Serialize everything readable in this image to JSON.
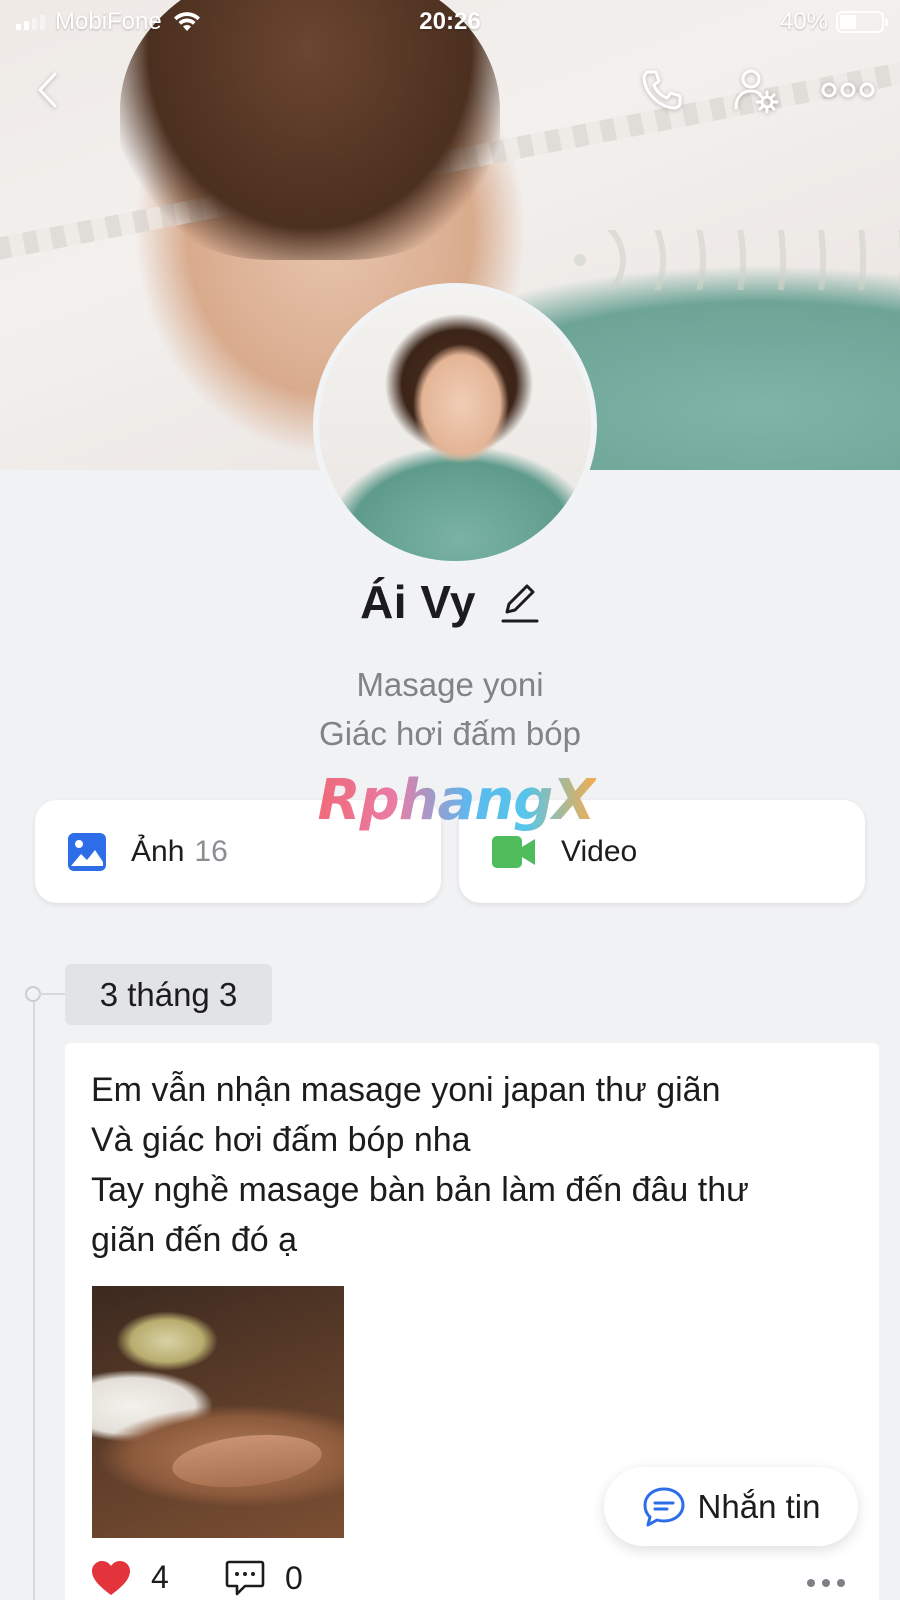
{
  "status_bar": {
    "carrier": "MobiFone",
    "time": "20:26",
    "battery_percent": "40%",
    "battery_level": 0.4
  },
  "nav": {
    "back_icon": "chevron-left-icon",
    "call_icon": "phone-icon",
    "settings_icon": "user-settings-icon",
    "more_icon": "more-horizontal-icon"
  },
  "profile": {
    "name": "Ái Vy",
    "bio_line1": "Masage yoni",
    "bio_line2": "Giác hơi đấm bóp"
  },
  "watermark": "RphangX",
  "media": {
    "photos_label": "Ảnh",
    "photos_count": "16",
    "video_label": "Video"
  },
  "timeline": {
    "date": "3 tháng 3"
  },
  "post": {
    "lines": [
      "Em vẫn nhận masage yoni japan thư giãn",
      "Và giác hơi đấm bóp nha",
      "Tay nghề masage bàn bản làm đến đâu thư",
      "giãn đến đó ạ"
    ],
    "likes": "4",
    "comments": "0"
  },
  "message_button": {
    "label": "Nhắn tin"
  },
  "colors": {
    "accent_blue": "#2d6ee8",
    "video_green": "#4fbd5c",
    "heart_red": "#e3343b",
    "background": "#f1f2f4"
  }
}
